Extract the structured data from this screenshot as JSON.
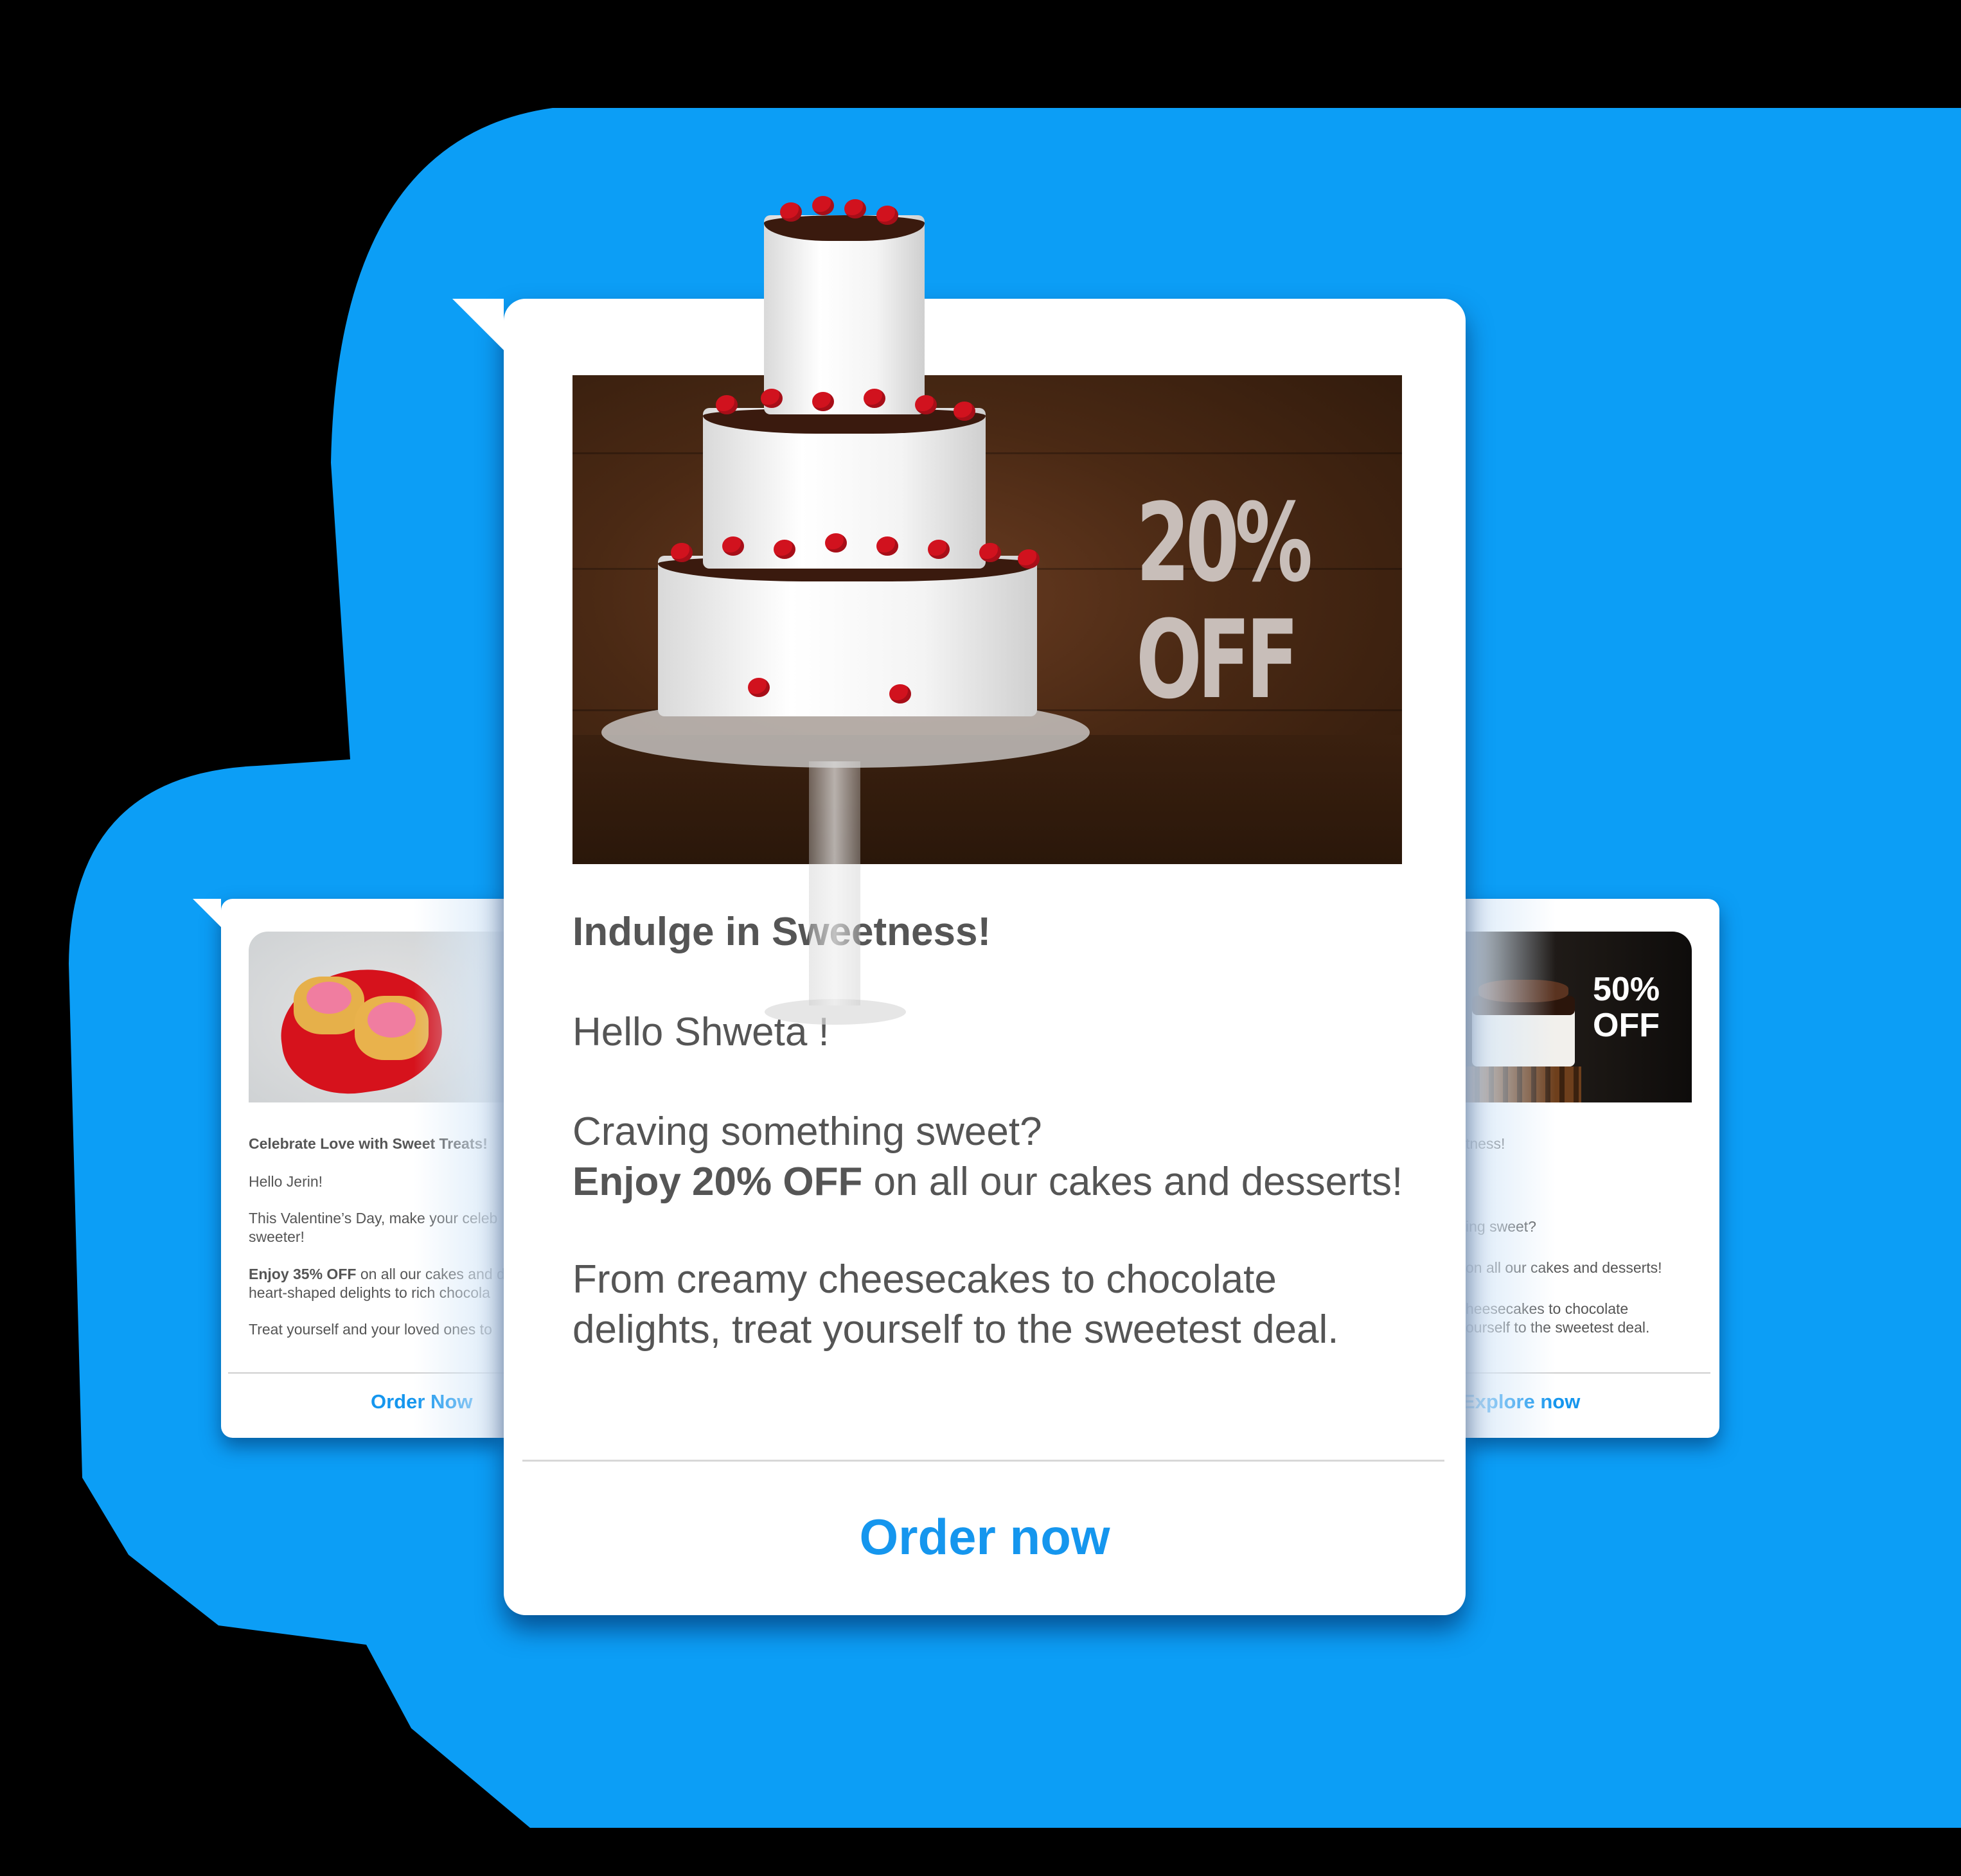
{
  "colors": {
    "background_blob": "#0c9ef6",
    "accent": "#1596ee",
    "text": "#555555"
  },
  "main_card": {
    "image_promo_line1": "20%",
    "image_promo_line2": "OFF",
    "title": "Indulge in Sweetness!",
    "greeting": "Hello Shweta !",
    "line1": "Craving something sweet?",
    "offer_bold": "Enjoy 20% OFF",
    "offer_rest": " on all our cakes and desserts!",
    "line3": "From creamy cheesecakes to chocolate",
    "line4": "delights, treat yourself to the sweetest deal.",
    "cta": "Order now"
  },
  "left_card": {
    "title": "Celebrate Love with Sweet Treats!",
    "greeting": "Hello Jerin!",
    "line1": "This Valentine’s Day, make your celeb",
    "line2": "sweeter!",
    "offer_bold": "Enjoy 35% OFF",
    "offer_rest": " on all our cakes and d",
    "line4": "heart-shaped delights to rich chocola",
    "line5": "Treat yourself and your loved ones to",
    "cta": "Order Now"
  },
  "right_card": {
    "image_promo_line1": "50%",
    "image_promo_line2": "OFF",
    "title": "tness!",
    "line1": "ing sweet?",
    "line2": "on all our cakes and desserts!",
    "line3": "heesecakes to chocolate",
    "line4": "ourself to the sweetest deal.",
    "cta": "Explore now"
  }
}
